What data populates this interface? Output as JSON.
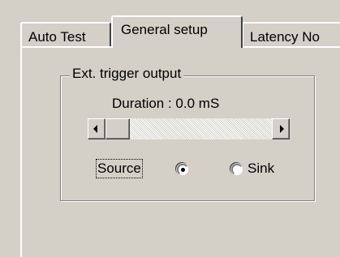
{
  "tabs": [
    {
      "label": "Auto Test",
      "selected": false
    },
    {
      "label": "General setup",
      "selected": true
    },
    {
      "label": "Latency No",
      "selected": false
    }
  ],
  "group": {
    "title": "Ext. trigger output",
    "duration_label": "Duration :  0.0 mS",
    "duration_value": 0.0,
    "duration_unit": "mS",
    "slider_position": 0.0
  },
  "radio": {
    "source_label": "Source",
    "sink_label": "Sink",
    "selected": "source"
  },
  "colors": {
    "face": "#d4d0c8",
    "highlight": "#ffffff",
    "shadow": "#808080",
    "dark_shadow": "#404040"
  },
  "icons": {
    "scroll_left": "left-arrow-icon",
    "scroll_right": "right-arrow-icon"
  }
}
